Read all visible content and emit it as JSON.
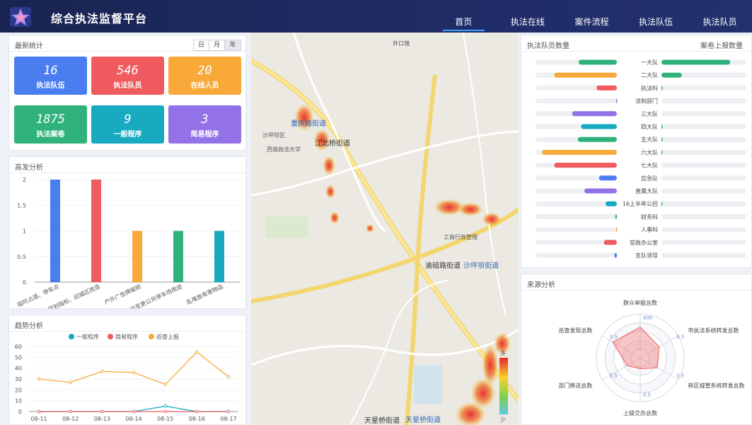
{
  "app": {
    "title": "综合执法监督平台",
    "logo_icon": "star-icon"
  },
  "nav": {
    "items": [
      "首页",
      "执法在线",
      "案件流程",
      "执法队伍",
      "执法队员"
    ],
    "active": 0
  },
  "stats": {
    "title": "最新统计",
    "periods": [
      "日",
      "月",
      "年"
    ],
    "selected_period": "年",
    "cards": [
      {
        "value": "16",
        "label": "执法队伍",
        "color": "#4a7ef0"
      },
      {
        "value": "546",
        "label": "执法队员",
        "color": "#ef5b5f"
      },
      {
        "value": "20",
        "label": "在线人员",
        "color": "#f8a93a"
      },
      {
        "value": "1875",
        "label": "执法案卷",
        "color": "#2fb27c"
      },
      {
        "value": "9",
        "label": "一般程序",
        "color": "#17aac0"
      },
      {
        "value": "3",
        "label": "简易程序",
        "color": "#9272e6"
      }
    ]
  },
  "high_freq": {
    "title": "高发分析"
  },
  "trend": {
    "title": "趋势分析"
  },
  "team": {
    "title": "执法队员数量",
    "right_title": "案卷上报数量"
  },
  "source": {
    "title": "来源分析",
    "indicators": [
      "群众举报总数",
      "市执法系统转发总数",
      "新区城管系统转发总数",
      "上级交办总数",
      "部门移送总数",
      "巡查发现总数"
    ],
    "ring_labels": [
      "800",
      "0.5",
      "0.5",
      "0.5",
      "0.5",
      "0.5"
    ]
  },
  "map": {
    "labels": [
      "重庆路街道",
      "江北桥街道",
      "沙坪坝街道",
      "渝碚路街道",
      "天星桥街道",
      "工商行政管理",
      "天星桥街道",
      "井口镇",
      "西南政法大学",
      "沙坪坝区"
    ],
    "legend_high": "多",
    "legend_low": "少"
  },
  "chart_data": [
    {
      "type": "bar",
      "title": "高发分析",
      "categories": [
        "临时占道、停车点",
        "规划指标、旧城区改造",
        "户外广告牌破损",
        "擅自变更公共停车场用途",
        "乱堆放有害物品"
      ],
      "values": [
        2,
        2,
        1,
        1,
        1
      ],
      "colors": [
        "#4a7ef0",
        "#ef5b5f",
        "#f8a93a",
        "#2fb27c",
        "#17aac0"
      ],
      "ylim": [
        0,
        2
      ],
      "yticks": [
        0,
        0.5,
        1,
        1.5,
        2
      ]
    },
    {
      "type": "line",
      "title": "趋势分析",
      "x": [
        "08-11",
        "08-12",
        "08-13",
        "08-14",
        "08-15",
        "08-16",
        "08-17"
      ],
      "series": [
        {
          "name": "一般程序",
          "color": "#17aac0",
          "values": [
            0,
            0,
            0,
            0,
            5,
            0,
            0
          ]
        },
        {
          "name": "简易程序",
          "color": "#ef5b5f",
          "values": [
            0,
            0,
            0,
            0,
            0,
            0,
            0
          ]
        },
        {
          "name": "巡查上报",
          "color": "#f8a93a",
          "values": [
            30,
            27,
            37,
            36,
            25,
            55,
            32
          ]
        }
      ],
      "ylim": [
        0,
        60
      ],
      "yticks": [
        0,
        10,
        20,
        30,
        40,
        50,
        60
      ]
    },
    {
      "type": "bar",
      "title": "执法队员数量",
      "orientation": "horizontal",
      "categories": [
        "一大队",
        "二大队",
        "执法科",
        "法制部门",
        "三大队",
        "四大队",
        "五大队",
        "六大队",
        "七大队",
        "应急队",
        "直属大队",
        "16上半年公招",
        "财务科",
        "人事科",
        "党政办公室",
        "支队领导"
      ],
      "values": [
        47,
        77,
        25,
        1,
        55,
        44,
        48,
        92,
        77,
        22,
        40,
        14,
        2,
        1,
        16,
        3
      ],
      "colors": [
        "#2fb27c",
        "#f8a93a",
        "#ef5b5f",
        "#9272e6",
        "#9272e6",
        "#17aac0",
        "#2fb27c",
        "#f8a93a",
        "#ef5b5f",
        "#4a7ef0",
        "#9272e6",
        "#17aac0",
        "#2fb27c",
        "#f8a93a",
        "#ef5b5f",
        "#4a7ef0"
      ],
      "xlim": [
        0,
        100
      ]
    },
    {
      "type": "bar",
      "title": "案卷上报数量",
      "orientation": "horizontal",
      "categories": [
        "一大队",
        "二大队",
        "执法科",
        "法制部门",
        "三大队",
        "四大队",
        "五大队",
        "六大队",
        "七大队",
        "应急队",
        "直属大队",
        "16上半年公招",
        "财务科",
        "人事科",
        "党政办公室",
        "支队领导"
      ],
      "values": [
        81,
        24,
        1,
        0,
        0,
        1,
        1,
        1,
        0,
        0,
        0,
        1,
        0,
        0,
        0,
        0
      ],
      "color": "#2fb27c",
      "xlim": [
        0,
        100
      ]
    }
  ]
}
